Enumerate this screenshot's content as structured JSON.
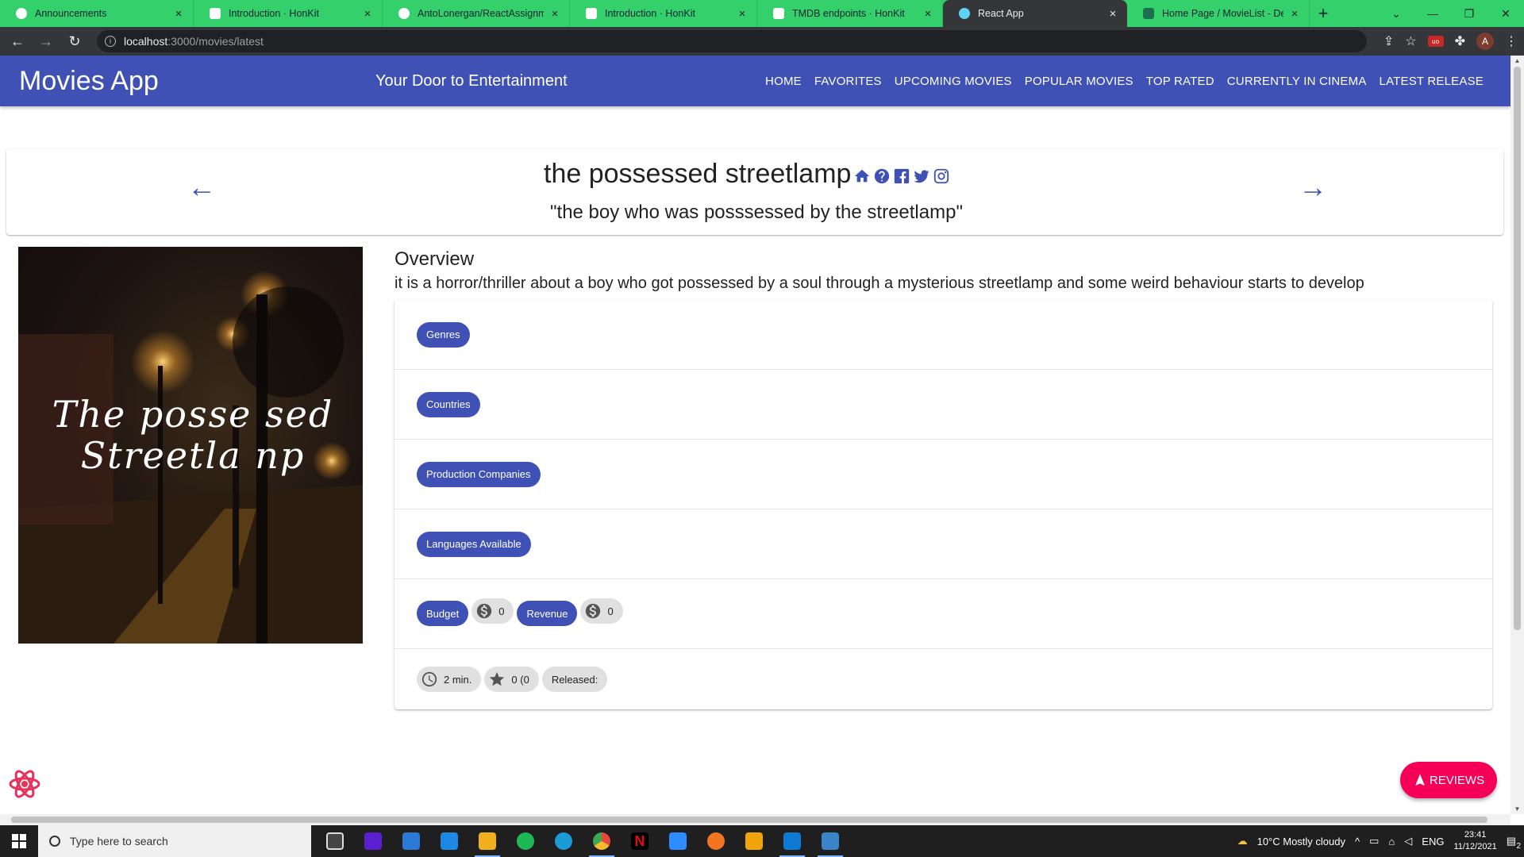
{
  "browser": {
    "tabs": [
      {
        "title": "Announcements",
        "favicon_color": "#ffffff",
        "active": false
      },
      {
        "title": "Introduction · HonKit",
        "favicon_color": "#ffffff",
        "active": false
      },
      {
        "title": "AntoLonergan/ReactAssignment",
        "favicon_color": "#ffffff",
        "active": false
      },
      {
        "title": "Introduction · HonKit",
        "favicon_color": "#ffffff",
        "active": false
      },
      {
        "title": "TMDB endpoints · HonKit",
        "favicon_color": "#ffffff",
        "active": false
      },
      {
        "title": "React App",
        "favicon_color": "#5fd3f3",
        "active": true
      },
      {
        "title": "Home Page / MovieList - Default",
        "favicon_color": "#1f6f4f",
        "active": false
      }
    ],
    "close_glyph": "×",
    "new_tab_glyph": "+",
    "url_host": "localhost",
    "url_path": ":3000/movies/latest",
    "profile_initial": "A"
  },
  "app": {
    "brand": "Movies App",
    "tagline": "Your Door to Entertainment",
    "nav": [
      "HOME",
      "FAVORITES",
      "UPCOMING MOVIES",
      "POPULAR MOVIES",
      "TOP RATED",
      "CURRENTLY IN CINEMA",
      "LATEST RELEASE"
    ],
    "accent_color": "#3f51b5",
    "fab_color": "#f50057"
  },
  "movie": {
    "title": "the possessed streetlamp",
    "tagline": "\"the boy who was posssessed by the streetlamp\"",
    "poster_text_line1": "The posse sed",
    "poster_text_line2": "Streetla np",
    "overview_heading": "Overview",
    "overview": "it is a horror/thriller about a boy who got possessed by a soul through a mysterious streetlamp and some weird behaviour starts to develop",
    "chips": {
      "genres": "Genres",
      "countries": "Countries",
      "production": "Production Companies",
      "languages": "Languages Available",
      "budget": "Budget",
      "budget_value": "0",
      "revenue": "Revenue",
      "revenue_value": "0",
      "runtime": "2 min.",
      "rating": "0 (0",
      "released": "Released:"
    },
    "reviews_button": "REVIEWS"
  },
  "taskbar": {
    "search_placeholder": "Type here to search",
    "weather": "10°C  Mostly cloudy",
    "language": "ENG",
    "time": "23:41",
    "date": "11/12/2021",
    "notification_count": "2",
    "apps": [
      {
        "name": "task-view",
        "color": "#444444"
      },
      {
        "name": "app-purple",
        "color": "#5b1fd1"
      },
      {
        "name": "microsoft-store",
        "color": "#2b79d6"
      },
      {
        "name": "mail",
        "color": "#1e88e5"
      },
      {
        "name": "file-explorer",
        "color": "#f2b01e"
      },
      {
        "name": "spotify",
        "color": "#1db954"
      },
      {
        "name": "edge",
        "color": "#1a9bd7"
      },
      {
        "name": "chrome",
        "color": "#e8453c"
      },
      {
        "name": "netflix",
        "color": "#000000"
      },
      {
        "name": "zoom",
        "color": "#2d8cff"
      },
      {
        "name": "crunchyroll",
        "color": "#f47521"
      },
      {
        "name": "office",
        "color": "#f0a30a"
      },
      {
        "name": "vscode",
        "color": "#0e7ad3"
      },
      {
        "name": "photos",
        "color": "#3a85c9"
      }
    ]
  }
}
